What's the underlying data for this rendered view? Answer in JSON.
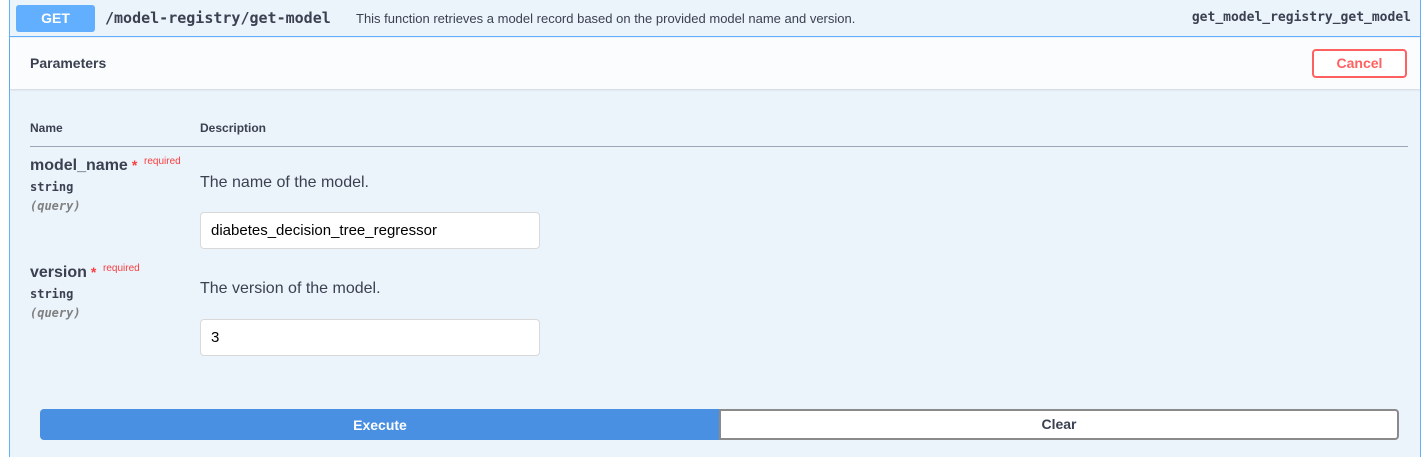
{
  "summary": {
    "method": "GET",
    "path": "/model-registry/get-model",
    "description": "This function retrieves a model record based on the provided model name and version.",
    "operation_id": "get_model_registry_get_model"
  },
  "parameters_section": {
    "title": "Parameters",
    "cancel_label": "Cancel"
  },
  "table": {
    "col_name": "Name",
    "col_description": "Description"
  },
  "params": [
    {
      "name": "model_name",
      "required_star": "*",
      "required_text": "required",
      "type": "string",
      "in": "(query)",
      "description": "The name of the model.",
      "value": "diabetes_decision_tree_regressor"
    },
    {
      "name": "version",
      "required_star": "*",
      "required_text": "required",
      "type": "string",
      "in": "(query)",
      "description": "The version of the model.",
      "value": "3"
    }
  ],
  "actions": {
    "execute_label": "Execute",
    "clear_label": "Clear"
  },
  "colors": {
    "get_accent": "#61affe",
    "execute": "#4990e2",
    "cancel": "#ff6060",
    "required": "#f93e3e"
  }
}
